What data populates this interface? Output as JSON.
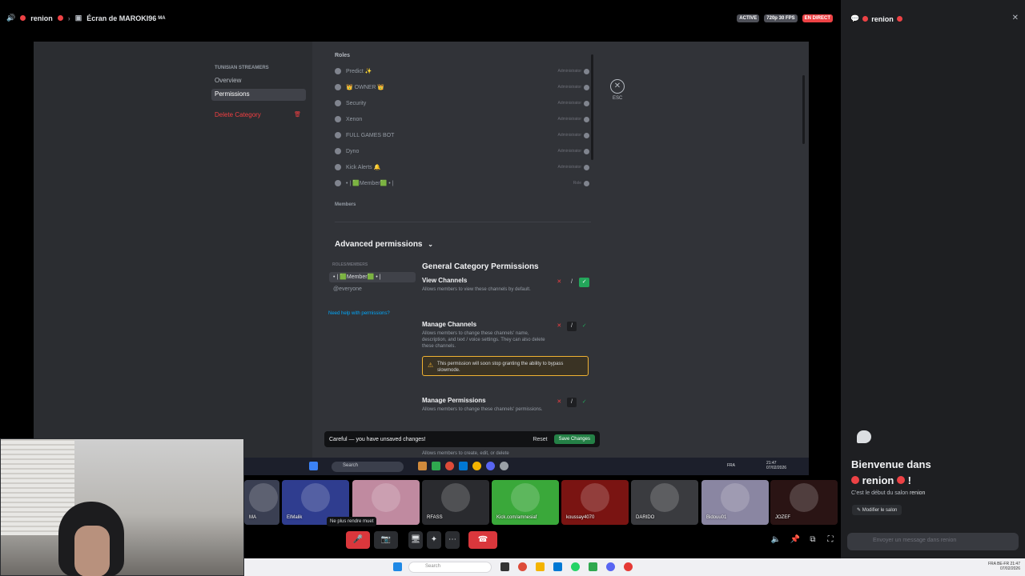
{
  "titlebar": {
    "channel": "renion",
    "screen_title": "Écran de MAROKI96",
    "screen_suffix": "MA",
    "badge_active": "ACTIVE",
    "badge_quality": "720p 30 FPS",
    "badge_live": "EN DIRECT"
  },
  "sidebar": {
    "category_header": "TUNISIAN STREAMERS",
    "items": [
      "Overview",
      "Permissions"
    ],
    "delete_label": "Delete Category"
  },
  "roles": {
    "label": "Roles",
    "rows": [
      {
        "name": "Predict ✨",
        "perm": "Administrator"
      },
      {
        "name": "👑 OWNER 👑",
        "perm": "Administrator"
      },
      {
        "name": "Security",
        "perm": "Administrator"
      },
      {
        "name": "Xenon",
        "perm": "Administrator"
      },
      {
        "name": "FULL GAMES BOT",
        "perm": "Administrator"
      },
      {
        "name": "Dyno",
        "perm": "Administrator"
      },
      {
        "name": "Kick Alerts 🔔",
        "perm": "Administrator"
      },
      {
        "name": "• | 🟩Member🟩 • |",
        "perm": "Role"
      }
    ],
    "members_label": "Members",
    "close_label": "ESC"
  },
  "advanced": {
    "title": "Advanced permissions",
    "roles_members_head": "ROLES/MEMBERS",
    "items": [
      "• | 🟩Member🟩 • |",
      "@everyone"
    ],
    "help_link": "Need help with permissions?",
    "section_title": "General Category Permissions",
    "perms": [
      {
        "name": "View Channels",
        "desc": "Allows members to view these channels by default."
      },
      {
        "name": "Manage Channels",
        "desc": "Allows members to change these channels' name, description, and text / voice settings. They can also delete these channels."
      },
      {
        "name": "Manage Permissions",
        "desc": "Allows members to change these channels' permissions."
      }
    ],
    "warning": "This permission will soon stop granting the ability to bypass slowmode.",
    "cutoff_text": "Allows members to create, edit, or delete"
  },
  "save_bar": {
    "message": "Careful — you have unsaved changes!",
    "reset": "Reset",
    "save": "Save Changes"
  },
  "inner_taskbar": {
    "search": "Search",
    "time": "21:47",
    "date": "07/02/2026",
    "lang": "FRA"
  },
  "tiles": [
    {
      "name": "MA",
      "color": "#3a3f52"
    },
    {
      "name": "ElMalik",
      "color": "#2f3d8f"
    },
    {
      "name": "",
      "color": "#c08aa0"
    },
    {
      "name": "RFASS",
      "color": "#2a2b2f"
    },
    {
      "name": "Kick.com/amnesiaf",
      "color": "#3aa83a"
    },
    {
      "name": "koussay4070",
      "color": "#7a1412"
    },
    {
      "name": "DARIDO",
      "color": "#3a3b3f"
    },
    {
      "name": "Bidouu01",
      "color": "#8a86a2"
    },
    {
      "name": "JOZEF",
      "color": "#2a1414"
    }
  ],
  "controls": {
    "tooltip": "Ne plus rendre muet"
  },
  "os_taskbar": {
    "search": "Search",
    "tray_lang": "FRA",
    "tray_lang2": "BE-FR",
    "time": "21:47",
    "date": "07/02/2026"
  },
  "chat": {
    "channel": "renion",
    "welcome_line1": "Bienvenue dans",
    "welcome_line2": "renion",
    "welcome_suffix": "!",
    "sub": "C'est le début du salon",
    "sub_channel": "renion",
    "edit": "Modifier le salon",
    "placeholder": "Envoyer un message dans renion"
  }
}
